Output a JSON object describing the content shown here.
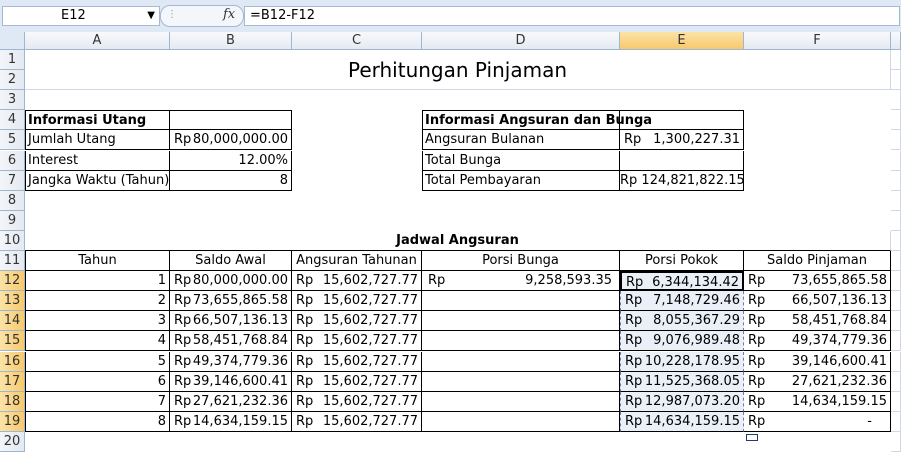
{
  "formula_bar": {
    "name_box": "E12",
    "formula": "=B12-F12",
    "fx_label": "fx"
  },
  "columns": [
    "A",
    "B",
    "C",
    "D",
    "E",
    "F"
  ],
  "rows": [
    "1",
    "2",
    "3",
    "4",
    "5",
    "6",
    "7",
    "8",
    "9",
    "10",
    "11",
    "12",
    "13",
    "14",
    "15",
    "16",
    "17",
    "18",
    "19",
    "20"
  ],
  "title": "Perhitungan Pinjaman",
  "info_utang": {
    "header": "Informasi Utang",
    "jumlah_label": "Jumlah Utang",
    "jumlah_cur": "Rp",
    "jumlah_val": "80,000,000.00",
    "interest_label": "Interest",
    "interest_val": "12.00%",
    "jangka_label": "Jangka Waktu (Tahun)",
    "jangka_val": "8"
  },
  "info_angsuran": {
    "header": "Informasi Angsuran dan Bunga",
    "bulanan_label": "Angsuran Bulanan",
    "bulanan_cur": "Rp",
    "bulanan_val": "1,300,227.31",
    "bunga_label": "Total Bunga",
    "pembayaran_label": "Total Pembayaran",
    "pembayaran_val": "Rp 124,821,822.15"
  },
  "jadwal": {
    "title": "Jadwal Angsuran",
    "headers": [
      "Tahun",
      "Saldo Awal",
      "Angsuran Tahunan",
      "Porsi Bunga",
      "Porsi Pokok",
      "Saldo Pinjaman"
    ],
    "currency": "Rp",
    "rows": [
      {
        "tahun": "1",
        "saldo_awal": "80,000,000.00",
        "angsuran": "15,602,727.77",
        "bunga": "9,258,593.35",
        "pokok": "6,344,134.42",
        "saldo": "73,655,865.58"
      },
      {
        "tahun": "2",
        "saldo_awal": "73,655,865.58",
        "angsuran": "15,602,727.77",
        "bunga": "",
        "pokok": "7,148,729.46",
        "saldo": "66,507,136.13"
      },
      {
        "tahun": "3",
        "saldo_awal": "66,507,136.13",
        "angsuran": "15,602,727.77",
        "bunga": "",
        "pokok": "8,055,367.29",
        "saldo": "58,451,768.84"
      },
      {
        "tahun": "4",
        "saldo_awal": "58,451,768.84",
        "angsuran": "15,602,727.77",
        "bunga": "",
        "pokok": "9,076,989.48",
        "saldo": "49,374,779.36"
      },
      {
        "tahun": "5",
        "saldo_awal": "49,374,779.36",
        "angsuran": "15,602,727.77",
        "bunga": "",
        "pokok": "10,228,178.95",
        "saldo": "39,146,600.41"
      },
      {
        "tahun": "6",
        "saldo_awal": "39,146,600.41",
        "angsuran": "15,602,727.77",
        "bunga": "",
        "pokok": "11,525,368.05",
        "saldo": "27,621,232.36"
      },
      {
        "tahun": "7",
        "saldo_awal": "27,621,232.36",
        "angsuran": "15,602,727.77",
        "bunga": "",
        "pokok": "12,987,073.20",
        "saldo": "14,634,159.15"
      },
      {
        "tahun": "8",
        "saldo_awal": "14,634,159.15",
        "angsuran": "15,602,727.77",
        "bunga": "",
        "pokok": "14,634,159.15",
        "saldo": "-"
      }
    ]
  }
}
